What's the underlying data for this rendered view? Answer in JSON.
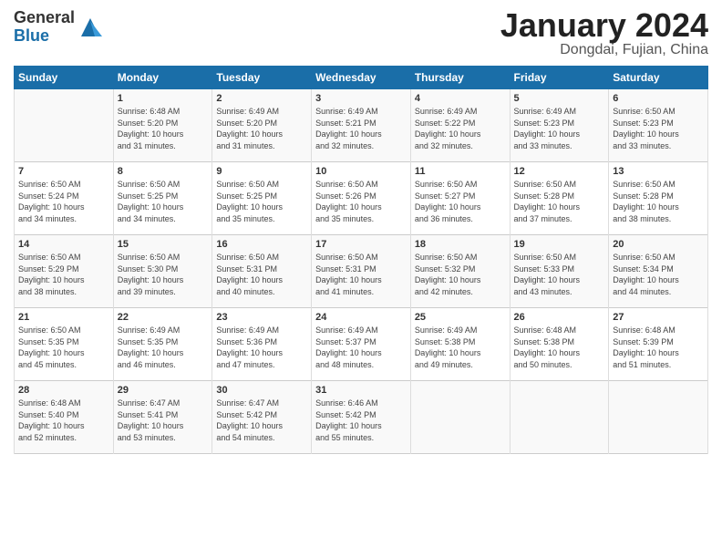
{
  "header": {
    "logo_general": "General",
    "logo_blue": "Blue",
    "month_title": "January 2024",
    "location": "Dongdai, Fujian, China"
  },
  "days_of_week": [
    "Sunday",
    "Monday",
    "Tuesday",
    "Wednesday",
    "Thursday",
    "Friday",
    "Saturday"
  ],
  "weeks": [
    [
      {
        "day": "",
        "info": ""
      },
      {
        "day": "1",
        "info": "Sunrise: 6:48 AM\nSunset: 5:20 PM\nDaylight: 10 hours\nand 31 minutes."
      },
      {
        "day": "2",
        "info": "Sunrise: 6:49 AM\nSunset: 5:20 PM\nDaylight: 10 hours\nand 31 minutes."
      },
      {
        "day": "3",
        "info": "Sunrise: 6:49 AM\nSunset: 5:21 PM\nDaylight: 10 hours\nand 32 minutes."
      },
      {
        "day": "4",
        "info": "Sunrise: 6:49 AM\nSunset: 5:22 PM\nDaylight: 10 hours\nand 32 minutes."
      },
      {
        "day": "5",
        "info": "Sunrise: 6:49 AM\nSunset: 5:23 PM\nDaylight: 10 hours\nand 33 minutes."
      },
      {
        "day": "6",
        "info": "Sunrise: 6:50 AM\nSunset: 5:23 PM\nDaylight: 10 hours\nand 33 minutes."
      }
    ],
    [
      {
        "day": "7",
        "info": "Sunrise: 6:50 AM\nSunset: 5:24 PM\nDaylight: 10 hours\nand 34 minutes."
      },
      {
        "day": "8",
        "info": "Sunrise: 6:50 AM\nSunset: 5:25 PM\nDaylight: 10 hours\nand 34 minutes."
      },
      {
        "day": "9",
        "info": "Sunrise: 6:50 AM\nSunset: 5:25 PM\nDaylight: 10 hours\nand 35 minutes."
      },
      {
        "day": "10",
        "info": "Sunrise: 6:50 AM\nSunset: 5:26 PM\nDaylight: 10 hours\nand 35 minutes."
      },
      {
        "day": "11",
        "info": "Sunrise: 6:50 AM\nSunset: 5:27 PM\nDaylight: 10 hours\nand 36 minutes."
      },
      {
        "day": "12",
        "info": "Sunrise: 6:50 AM\nSunset: 5:28 PM\nDaylight: 10 hours\nand 37 minutes."
      },
      {
        "day": "13",
        "info": "Sunrise: 6:50 AM\nSunset: 5:28 PM\nDaylight: 10 hours\nand 38 minutes."
      }
    ],
    [
      {
        "day": "14",
        "info": "Sunrise: 6:50 AM\nSunset: 5:29 PM\nDaylight: 10 hours\nand 38 minutes."
      },
      {
        "day": "15",
        "info": "Sunrise: 6:50 AM\nSunset: 5:30 PM\nDaylight: 10 hours\nand 39 minutes."
      },
      {
        "day": "16",
        "info": "Sunrise: 6:50 AM\nSunset: 5:31 PM\nDaylight: 10 hours\nand 40 minutes."
      },
      {
        "day": "17",
        "info": "Sunrise: 6:50 AM\nSunset: 5:31 PM\nDaylight: 10 hours\nand 41 minutes."
      },
      {
        "day": "18",
        "info": "Sunrise: 6:50 AM\nSunset: 5:32 PM\nDaylight: 10 hours\nand 42 minutes."
      },
      {
        "day": "19",
        "info": "Sunrise: 6:50 AM\nSunset: 5:33 PM\nDaylight: 10 hours\nand 43 minutes."
      },
      {
        "day": "20",
        "info": "Sunrise: 6:50 AM\nSunset: 5:34 PM\nDaylight: 10 hours\nand 44 minutes."
      }
    ],
    [
      {
        "day": "21",
        "info": "Sunrise: 6:50 AM\nSunset: 5:35 PM\nDaylight: 10 hours\nand 45 minutes."
      },
      {
        "day": "22",
        "info": "Sunrise: 6:49 AM\nSunset: 5:35 PM\nDaylight: 10 hours\nand 46 minutes."
      },
      {
        "day": "23",
        "info": "Sunrise: 6:49 AM\nSunset: 5:36 PM\nDaylight: 10 hours\nand 47 minutes."
      },
      {
        "day": "24",
        "info": "Sunrise: 6:49 AM\nSunset: 5:37 PM\nDaylight: 10 hours\nand 48 minutes."
      },
      {
        "day": "25",
        "info": "Sunrise: 6:49 AM\nSunset: 5:38 PM\nDaylight: 10 hours\nand 49 minutes."
      },
      {
        "day": "26",
        "info": "Sunrise: 6:48 AM\nSunset: 5:38 PM\nDaylight: 10 hours\nand 50 minutes."
      },
      {
        "day": "27",
        "info": "Sunrise: 6:48 AM\nSunset: 5:39 PM\nDaylight: 10 hours\nand 51 minutes."
      }
    ],
    [
      {
        "day": "28",
        "info": "Sunrise: 6:48 AM\nSunset: 5:40 PM\nDaylight: 10 hours\nand 52 minutes."
      },
      {
        "day": "29",
        "info": "Sunrise: 6:47 AM\nSunset: 5:41 PM\nDaylight: 10 hours\nand 53 minutes."
      },
      {
        "day": "30",
        "info": "Sunrise: 6:47 AM\nSunset: 5:42 PM\nDaylight: 10 hours\nand 54 minutes."
      },
      {
        "day": "31",
        "info": "Sunrise: 6:46 AM\nSunset: 5:42 PM\nDaylight: 10 hours\nand 55 minutes."
      },
      {
        "day": "",
        "info": ""
      },
      {
        "day": "",
        "info": ""
      },
      {
        "day": "",
        "info": ""
      }
    ]
  ]
}
